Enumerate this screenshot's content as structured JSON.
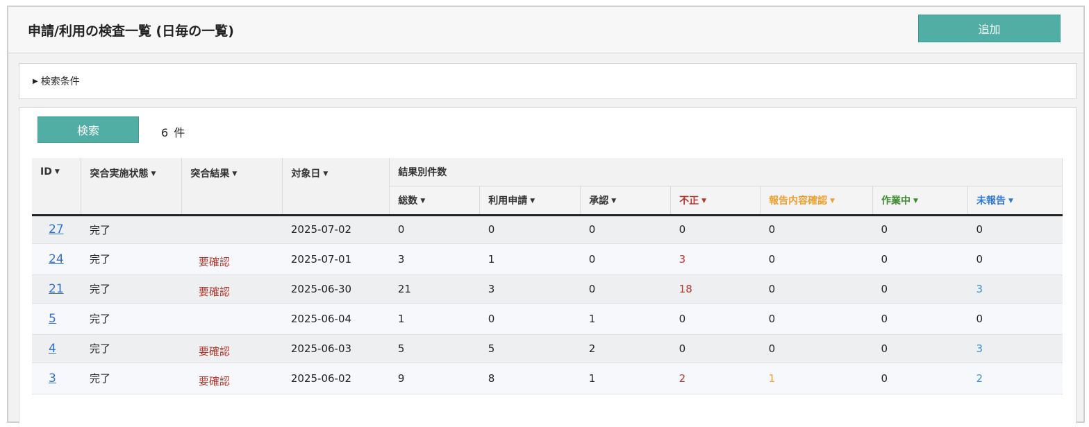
{
  "header": {
    "title": "申請/利用の検査一覧 (日毎の一覧)",
    "add_label": "追加"
  },
  "search": {
    "toggle_label": "検索条件",
    "button_label": "検索",
    "count_value": "6",
    "count_unit": "件"
  },
  "table": {
    "headers": {
      "id": "ID",
      "status": "突合実施状態",
      "result": "突合結果",
      "date": "対象日",
      "group": "結果別件数",
      "total": "総数",
      "apply": "利用申請",
      "approve": "承認",
      "fraud": "不正",
      "report_check": "報告内容確認",
      "working": "作業中",
      "unreported": "未報告"
    },
    "rows": [
      {
        "id": "27",
        "status": "完了",
        "result": "",
        "date": "2025-07-02",
        "total": "0",
        "apply": "0",
        "approve": "0",
        "fraud": "0",
        "report_check": "0",
        "working": "0",
        "unreported": "0"
      },
      {
        "id": "24",
        "status": "完了",
        "result": "要確認",
        "date": "2025-07-01",
        "total": "3",
        "apply": "1",
        "approve": "0",
        "fraud": "3",
        "report_check": "0",
        "working": "0",
        "unreported": "0"
      },
      {
        "id": "21",
        "status": "完了",
        "result": "要確認",
        "date": "2025-06-30",
        "total": "21",
        "apply": "3",
        "approve": "0",
        "fraud": "18",
        "report_check": "0",
        "working": "0",
        "unreported": "3"
      },
      {
        "id": "5",
        "status": "完了",
        "result": "",
        "date": "2025-06-04",
        "total": "1",
        "apply": "0",
        "approve": "1",
        "fraud": "0",
        "report_check": "0",
        "working": "0",
        "unreported": "0"
      },
      {
        "id": "4",
        "status": "完了",
        "result": "要確認",
        "date": "2025-06-03",
        "total": "5",
        "apply": "5",
        "approve": "2",
        "fraud": "0",
        "report_check": "0",
        "working": "0",
        "unreported": "3"
      },
      {
        "id": "3",
        "status": "完了",
        "result": "要確認",
        "date": "2025-06-02",
        "total": "9",
        "apply": "8",
        "approve": "1",
        "fraud": "2",
        "report_check": "1",
        "working": "0",
        "unreported": "2"
      }
    ]
  },
  "colors": {
    "accent": "#50aea4",
    "fraud": "#b8352b",
    "report_check": "#f0a030",
    "working": "#3c8a2e",
    "unreported": "#2f78d8",
    "link": "#2f6fd8"
  }
}
